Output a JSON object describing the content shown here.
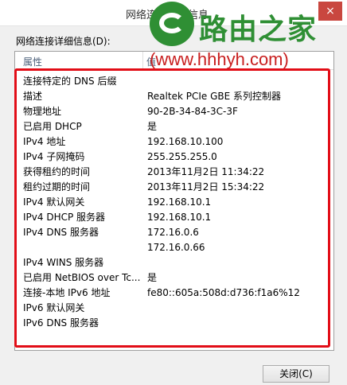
{
  "window": {
    "title": "网络连接详细信息",
    "close_glyph": "×"
  },
  "watermark": {
    "name": "路由之家",
    "url": "(www.hhhyh.com)"
  },
  "details": {
    "label": "网络连接详细信息(D):",
    "columns": [
      "属性",
      "值"
    ],
    "rows": [
      {
        "property": "连接特定的 DNS 后缀",
        "value": ""
      },
      {
        "property": "描述",
        "value": "Realtek PCIe GBE 系列控制器"
      },
      {
        "property": "物理地址",
        "value": "90-2B-34-84-3C-3F"
      },
      {
        "property": "已启用 DHCP",
        "value": "是"
      },
      {
        "property": "IPv4 地址",
        "value": "192.168.10.100"
      },
      {
        "property": "IPv4 子网掩码",
        "value": "255.255.255.0"
      },
      {
        "property": "获得租约的时间",
        "value": "2013年11月2日 11:34:22"
      },
      {
        "property": "租约过期的时间",
        "value": "2013年11月2日 15:34:22"
      },
      {
        "property": "IPv4 默认网关",
        "value": "192.168.10.1"
      },
      {
        "property": "IPv4 DHCP 服务器",
        "value": "192.168.10.1"
      },
      {
        "property": "IPv4 DNS 服务器",
        "value": "172.16.0.6"
      },
      {
        "property": "",
        "value": "172.16.0.66"
      },
      {
        "property": "IPv4 WINS 服务器",
        "value": ""
      },
      {
        "property": "已启用 NetBIOS over Tc...",
        "value": "是"
      },
      {
        "property": "连接-本地 IPv6 地址",
        "value": "fe80::605a:508d:d736:f1a6%12"
      },
      {
        "property": "IPv6 默认网关",
        "value": ""
      },
      {
        "property": "IPv6 DNS 服务器",
        "value": ""
      }
    ]
  },
  "buttons": {
    "close_label": "关闭(C)"
  },
  "colors": {
    "highlight": "#e20d17",
    "watermark_green": "#2f8f34",
    "watermark_red": "#c81f1f"
  }
}
